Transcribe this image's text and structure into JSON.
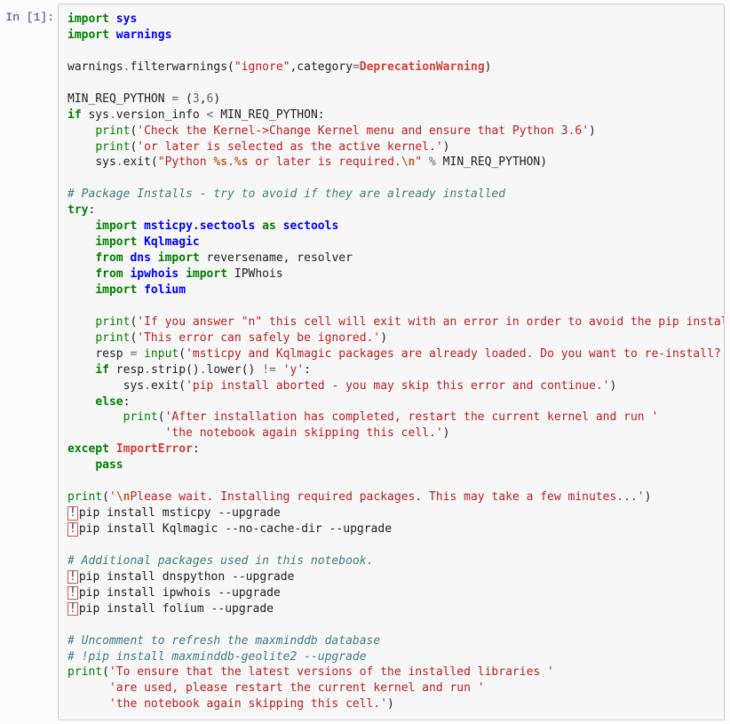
{
  "prompt": "In [1]:",
  "code": {
    "l1": {
      "import": "import",
      "mod": "sys"
    },
    "l2": {
      "import": "import",
      "mod": "warnings"
    },
    "l3": {
      "obj": "warnings",
      "dot": ".",
      "fn": "filterwarnings(",
      "str": "\"ignore\"",
      "comma": ",category",
      "eq": "=",
      "exc": "DeprecationWarning",
      "close": ")"
    },
    "l4": {
      "name": "MIN_REQ_PYTHON ",
      "eq": "=",
      "val": " (",
      "n1": "3",
      "c": ",",
      "n2": "6",
      "close": ")"
    },
    "l5": {
      "kw": "if",
      "sp": " sys",
      "dot": ".",
      "attr": "version_info ",
      "op": "<",
      "rest": " MIN_REQ_PYTHON:"
    },
    "l6": {
      "fn": "print",
      "open": "(",
      "str": "'Check the Kernel->Change Kernel menu and ensure that Python 3.6'",
      "close": ")"
    },
    "l7": {
      "fn": "print",
      "open": "(",
      "str": "'or later is selected as the active kernel.'",
      "close": ")"
    },
    "l8": {
      "obj": "sys",
      "dot": ".",
      "fn": "exit(",
      "s1": "\"Python ",
      "pct1": "%s",
      "mid": ".",
      "pct2": "%s",
      "s2": " or later is required.",
      "esc": "\\n",
      "s3": "\" ",
      "op": "%",
      "var": " MIN_REQ_PYTHON)"
    },
    "c1": "# Package Installs - try to avoid if they are already installed",
    "l9": {
      "kw": "try",
      "colon": ":"
    },
    "l10": {
      "import": "import",
      "mod": "msticpy.sectools",
      "as": "as",
      "alias": "sectools"
    },
    "l11": {
      "import": "import",
      "mod": "Kqlmagic"
    },
    "l12": {
      "from": "from",
      "mod": "dns",
      "import": "import",
      "names": " reversename, resolver"
    },
    "l13": {
      "from": "from",
      "mod": "ipwhois",
      "import": "import",
      "names": " IPWhois"
    },
    "l14": {
      "import": "import",
      "mod": "folium"
    },
    "l15": {
      "fn": "print",
      "open": "(",
      "str": "'If you answer \"n\" this cell will exit with an error in order to avoid the pip install calls,'",
      "close": ")"
    },
    "l16": {
      "fn": "print",
      "open": "(",
      "str": "'This error can safely be ignored.'",
      "close": ")"
    },
    "l17": {
      "var": "resp ",
      "eq": "=",
      "fn": " input",
      "open": "(",
      "str": "'msticpy and Kqlmagic packages are already loaded. Do you want to re-install? (y/n)'",
      "close": ")"
    },
    "l18": {
      "kw": "if",
      "expr1": " resp",
      "dot1": ".",
      "m1": "strip()",
      "dot2": ".",
      "m2": "lower() ",
      "neq": "!=",
      "sp": " ",
      "str": "'y'",
      "colon": ":"
    },
    "l19": {
      "obj": "sys",
      "dot": ".",
      "fn": "exit(",
      "str": "'pip install aborted - you may skip this error and continue.'",
      "close": ")"
    },
    "l20": {
      "kw": "else",
      "colon": ":"
    },
    "l21": {
      "fn": "print",
      "open": "(",
      "str": "'After installation has completed, restart the current kernel and run '"
    },
    "l22": {
      "str": "'the notebook again skipping this cell.'",
      "close": ")"
    },
    "l23": {
      "kw": "except",
      "exc": "ImportError",
      "colon": ":"
    },
    "l24": {
      "kw": "pass"
    },
    "l25": {
      "fn": "print",
      "open": "(",
      "s1": "'",
      "esc": "\\n",
      "s2": "Please wait. Installing required packages. This may take a few minutes...'",
      "close": ")"
    },
    "b1": {
      "bang": "!",
      "cmd": "pip install msticpy --upgrade"
    },
    "b2": {
      "bang": "!",
      "cmd": "pip install Kqlmagic --no-cache-dir --upgrade"
    },
    "c2": "# Additional packages used in this notebook.",
    "b3": {
      "bang": "!",
      "cmd": "pip install dnspython --upgrade"
    },
    "b4": {
      "bang": "!",
      "cmd": "pip install ipwhois --upgrade"
    },
    "b5": {
      "bang": "!",
      "cmd": "pip install folium --upgrade"
    },
    "c3": "# Uncomment to refresh the maxminddb database",
    "c4": "# !pip install maxminddb-geolite2 --upgrade",
    "l26": {
      "fn": "print",
      "open": "(",
      "str": "'To ensure that the latest versions of the installed libraries '"
    },
    "l27": {
      "str": "'are used, please restart the current kernel and run '"
    },
    "l28": {
      "str": "'the notebook again skipping this cell.'",
      "close": ")"
    }
  }
}
